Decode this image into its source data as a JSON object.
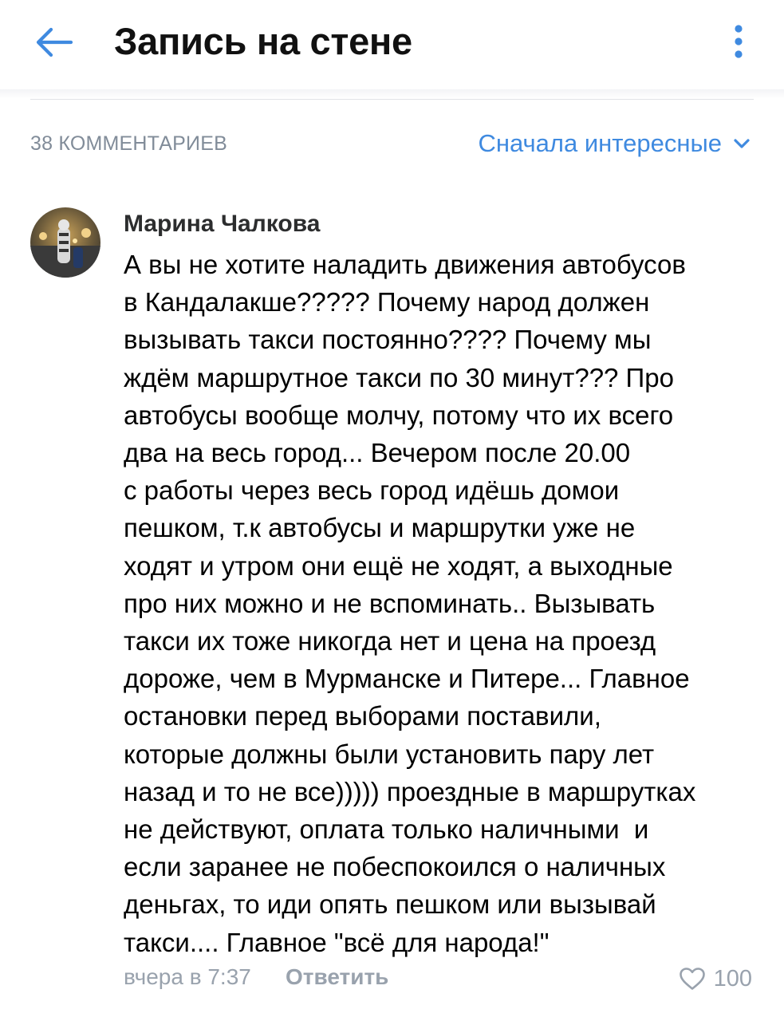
{
  "header": {
    "title": "Запись на стене",
    "back_icon": "arrow-left-icon",
    "more_icon": "more-vertical-icon",
    "accent_color": "#3f8ae0"
  },
  "comments_bar": {
    "count_label": "38 КОММЕНТАРИЕВ",
    "sort_label": "Сначала интересные",
    "sort_icon": "chevron-down-icon"
  },
  "comment": {
    "author": "Марина Чалкова",
    "text_lines": [
      "А вы не хотите наладить движения автобусов",
      "в Кандалакше????? Почему народ должен",
      "вызывать такси постоянно???? Почему мы",
      "ждём маршрутное такси по 30 минут??? Про",
      "автобусы вообще молчу, потому что их всего",
      "два на весь город... Вечером после 20.00",
      "с работы через весь город идёшь домои",
      "пешком, т.к автобусы и маршрутки уже не",
      "ходят и утром они ещё не ходят, а выходные",
      "про них можно и не вспоминать.. Вызывать",
      "такси их тоже никогда нет и цена на проезд",
      "дороже, чем в Мурманске и Питере... Главное",
      "остановки перед выборами поставили,",
      "которые должны были установить пару лет",
      "назад и то не все))))) проездные в маршрутках",
      "не действуют, оплата только наличными  и",
      "если заранее не побеспокоился о наличных",
      "деньгах, то иди опять пешком или вызывай",
      "такси.... Главное \"всё для народа!\""
    ],
    "time": "вчера в 7:37",
    "reply_label": "Ответить",
    "like_icon": "heart-outline-icon",
    "likes": "100"
  }
}
